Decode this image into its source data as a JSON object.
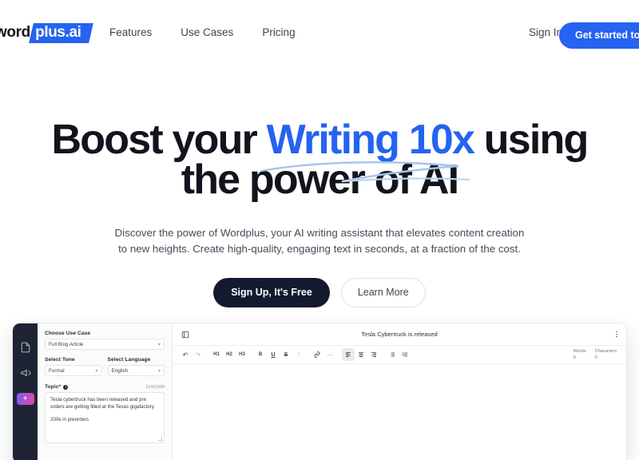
{
  "header": {
    "logo": {
      "word": "word",
      "badge": "plus.ai"
    },
    "nav": [
      {
        "label": "Features",
        "name": "nav-features"
      },
      {
        "label": "Use Cases",
        "name": "nav-use-cases"
      },
      {
        "label": "Pricing",
        "name": "nav-pricing"
      }
    ],
    "sign_in": "Sign In",
    "cta": "Get started today"
  },
  "hero": {
    "headline_part1": "Boost your ",
    "headline_highlight": "Writing 10x",
    "headline_part2": " using",
    "headline_line2": "the power of AI",
    "subtitle_line1": "Discover the power of Wordplus, your AI writing assistant that elevates content creation",
    "subtitle_line2": "to new heights. Create high-quality, engaging text in seconds, at a fraction of the cost.",
    "cta_primary": "Sign Up, It's Free",
    "cta_secondary": "Learn More"
  },
  "app": {
    "rail": {
      "documents_icon": "document-icon",
      "announcements_icon": "megaphone-icon",
      "add_label": "+"
    },
    "form": {
      "use_case_label": "Choose Use Case",
      "use_case_value": "Full Blog Article",
      "tone_label": "Select Tone",
      "tone_value": "Formal",
      "language_label": "Select Language",
      "language_value": "English",
      "topic_label": "Topic*",
      "topic_counter": "114/1000",
      "topic_text_p1": "Tesla cybertruck has been released and pre orders are getting filled at the Texas gigafactory.",
      "topic_text_p2": "200k in preorders"
    },
    "editor": {
      "title": "Tesla Cybertruck is released",
      "collapse_icon": "sidebar-collapse-icon",
      "menu_icon": "kebab-menu-icon",
      "toolbar": [
        {
          "name": "undo-button",
          "glyph": "↶",
          "style": ""
        },
        {
          "name": "redo-button",
          "glyph": "↷",
          "style": "muted"
        },
        {
          "name": "heading-1-button",
          "glyph": "H1",
          "style": "sm"
        },
        {
          "name": "heading-2-button",
          "glyph": "H2",
          "style": "sm"
        },
        {
          "name": "heading-3-button",
          "glyph": "H3",
          "style": "sm"
        },
        {
          "name": "bold-button",
          "glyph": "B",
          "style": "sm"
        },
        {
          "name": "underline-button",
          "glyph": "U",
          "style": ""
        },
        {
          "name": "strikethrough-button",
          "glyph": "S",
          "style": ""
        },
        {
          "name": "italic-button",
          "glyph": "I",
          "style": "muted"
        },
        {
          "name": "link-button",
          "glyph": "🔗",
          "style": ""
        },
        {
          "name": "horizontal-rule-button",
          "glyph": "—",
          "style": "muted"
        },
        {
          "name": "align-left-button",
          "glyph": "≡",
          "style": "active"
        },
        {
          "name": "align-center-button",
          "glyph": "≡",
          "style": ""
        },
        {
          "name": "align-right-button",
          "glyph": "≡",
          "style": ""
        },
        {
          "name": "bullet-list-button",
          "glyph": "☰",
          "style": ""
        },
        {
          "name": "numbered-list-button",
          "glyph": "☰",
          "style": ""
        }
      ],
      "words_label": "Words",
      "words_value": "0",
      "characters_label": "Characters",
      "characters_value": "0"
    }
  },
  "colors": {
    "brand_blue": "#2563f0",
    "dark": "#141a2e",
    "rail_dark": "#1e2433",
    "swoosh": "#a8c3ea"
  }
}
